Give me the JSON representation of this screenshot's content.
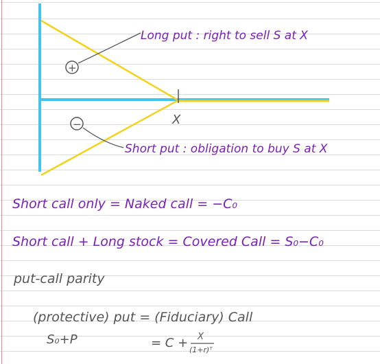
{
  "colors": {
    "axis": "#44c4ec",
    "payoff_lines": "#f2d21a",
    "notes_purple": "#7a1fb8",
    "notes_gray": "#555555"
  },
  "diagram": {
    "long_put_label": "Long put : right to sell S at X",
    "short_put_label": "Short put : obligation to buy S at X",
    "plus_symbol": "+",
    "minus_symbol": "−",
    "x_marker": "X"
  },
  "notes": {
    "line1": "Short call only = Naked call = −C₀",
    "line2": "Short call + Long stock = Covered Call = S₀−C₀",
    "line3": "put-call parity",
    "line4": "(protective) put = (Fiduciary) Call",
    "line5_left": "S₀+P",
    "line5_right": "= C +",
    "fraction_num": "X",
    "fraction_den": "(1+r)ᵀ"
  }
}
